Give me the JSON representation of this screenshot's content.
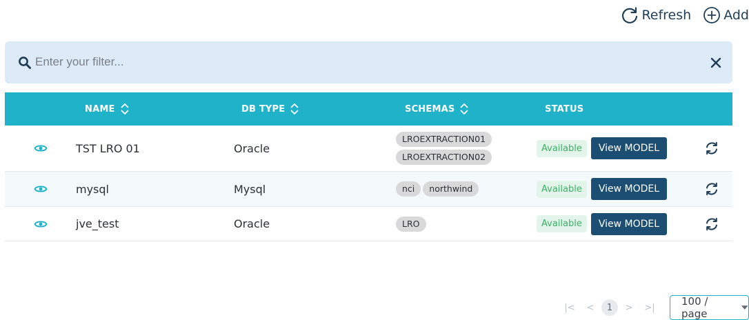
{
  "toolbar": {
    "refresh_label": "Refresh",
    "add_label": "Add",
    "refresh_icon": "refresh-icon",
    "add_icon": "plus-circle-icon"
  },
  "filter": {
    "placeholder": "Enter your filter...",
    "value": "",
    "search_icon": "search-icon",
    "clear_icon": "close-icon"
  },
  "table": {
    "headers": {
      "name": "NAME",
      "db_type": "DB TYPE",
      "schemas": "SCHEMAS",
      "status": "STATUS"
    },
    "rows": [
      {
        "name": "TST LRO 01",
        "db_type": "Oracle",
        "schemas": [
          "LROEXTRACTION01",
          "LROEXTRACTION02"
        ],
        "status": "Available",
        "action": "View MODEL"
      },
      {
        "name": "mysql",
        "db_type": "Mysql",
        "schemas": [
          "nci",
          "northwind"
        ],
        "status": "Available",
        "action": "View MODEL"
      },
      {
        "name": "jve_test",
        "db_type": "Oracle",
        "schemas": [
          "LRO"
        ],
        "status": "Available",
        "action": "View MODEL"
      }
    ]
  },
  "pagination": {
    "first": "|<",
    "prev": "<",
    "current_page": "1",
    "next": ">",
    "last": ">|",
    "page_size": "100 / page"
  },
  "colors": {
    "header_bg": "#1fb2c8",
    "filter_bg": "#dcebf7",
    "view_button": "#1c4e73",
    "status_text": "#3fae66",
    "status_bg": "#e3f5ea",
    "eye_icon": "#1fb2c8"
  }
}
